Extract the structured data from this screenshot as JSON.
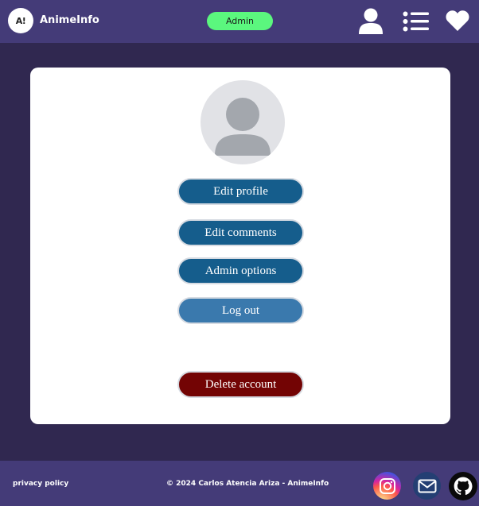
{
  "header": {
    "logo_text": "A!",
    "app_name": "AnimeInfo",
    "role_badge": "Admin",
    "icons": [
      "user-icon",
      "menu-list-icon",
      "heart-icon"
    ]
  },
  "profile": {
    "avatar_icon": "default-avatar-icon",
    "buttons": {
      "edit_profile": "Edit profile",
      "edit_comments": "Edit comments",
      "admin_options": "Admin options",
      "log_out": "Log out",
      "delete_account": "Delete account"
    }
  },
  "footer": {
    "privacy": "privacy policy",
    "copyright": "© 2024 Carlos Atencia Ariza - AnimeInfo",
    "social": [
      "instagram-icon",
      "mail-icon",
      "github-icon"
    ]
  },
  "colors": {
    "background": "#302850",
    "bar": "#443b78",
    "admin_badge": "#5bf77e",
    "button_primary": "#155d8c",
    "button_logout": "#3a79ad",
    "button_danger": "#730404"
  }
}
